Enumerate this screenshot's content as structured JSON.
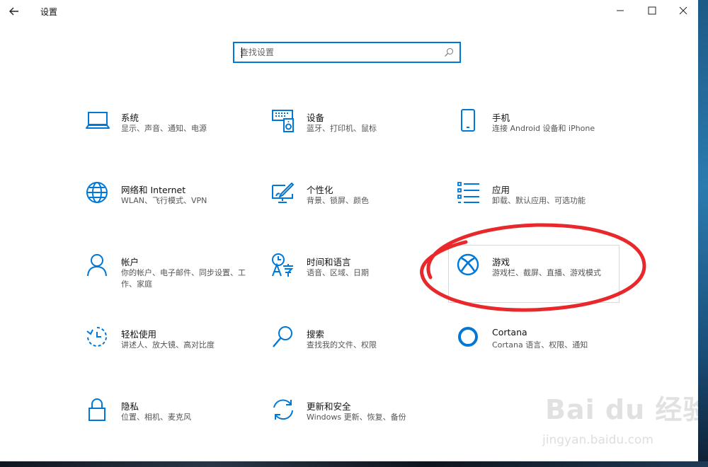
{
  "window": {
    "title": "设置"
  },
  "search": {
    "placeholder": "查找设置"
  },
  "accent_color": "#0078d7",
  "annotation_color": "#e8282b",
  "tiles": [
    {
      "icon": "laptop-icon",
      "name": "系统",
      "desc": "显示、声音、通知、电源"
    },
    {
      "icon": "keyboard-speaker-icon",
      "name": "设备",
      "desc": "蓝牙、打印机、鼠标"
    },
    {
      "icon": "phone-icon",
      "name": "手机",
      "desc": "连接 Android 设备和 iPhone"
    },
    {
      "icon": "globe-icon",
      "name": "网络和 Internet",
      "desc": "WLAN、飞行模式、VPN"
    },
    {
      "icon": "paint-monitor-icon",
      "name": "个性化",
      "desc": "背景、锁屏、颜色"
    },
    {
      "icon": "app-list-icon",
      "name": "应用",
      "desc": "卸载、默认应用、可选功能"
    },
    {
      "icon": "person-icon",
      "name": "帐户",
      "desc": "你的帐户、电子邮件、同步设置、工作、家庭"
    },
    {
      "icon": "time-language-icon",
      "name": "时间和语言",
      "desc": "语音、区域、日期"
    },
    {
      "icon": "xbox-icon",
      "name": "游戏",
      "desc": "游戏栏、截屏、直播、游戏模式"
    },
    {
      "icon": "ease-of-access-icon",
      "name": "轻松使用",
      "desc": "讲述人、放大镜、高对比度"
    },
    {
      "icon": "search-icon",
      "name": "搜索",
      "desc": "查找我的文件、权限"
    },
    {
      "icon": "cortana-icon",
      "name": "Cortana",
      "desc": "Cortana 语言、权限、通知"
    },
    {
      "icon": "lock-icon",
      "name": "隐私",
      "desc": "位置、相机、麦克风"
    },
    {
      "icon": "update-sync-icon",
      "name": "更新和安全",
      "desc": "Windows 更新、恢复、备份"
    }
  ],
  "watermark": {
    "logo": "Bai du 经验",
    "url": "jingyan.baidu.com"
  }
}
